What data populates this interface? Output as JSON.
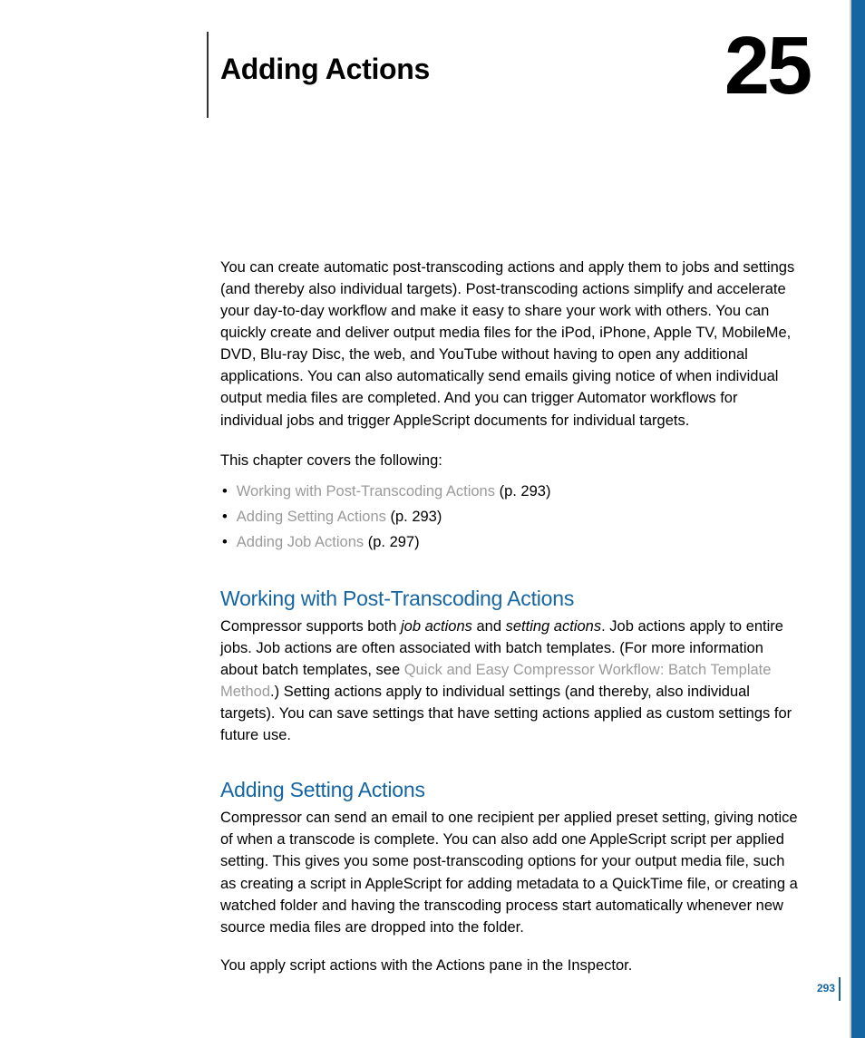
{
  "chapter": {
    "title": "Adding Actions",
    "number": "25"
  },
  "intro": "You can create automatic post-transcoding actions and apply them to jobs and settings (and thereby also individual targets). Post-transcoding actions simplify and accelerate your day-to-day workflow and make it easy to share your work with others. You can quickly create and deliver output media files for the iPod, iPhone, Apple TV, MobileMe, DVD, Blu-ray Disc, the web, and YouTube without having to open any additional applications. You can also automatically send emails giving notice of when individual output media files are completed. And you can trigger Automator workflows for individual jobs and trigger AppleScript documents for individual targets.",
  "covers_label": "This chapter covers the following:",
  "toc": [
    {
      "link": "Working with Post-Transcoding Actions",
      "page": " (p. 293)"
    },
    {
      "link": "Adding Setting Actions",
      "page": " (p. 293)"
    },
    {
      "link": "Adding Job Actions",
      "page": " (p. 297)"
    }
  ],
  "section1": {
    "heading": "Working with Post-Transcoding Actions",
    "pre": "Compressor supports both ",
    "ital1": "job actions",
    "mid1": " and ",
    "ital2": "setting actions",
    "post1": ". Job actions apply to entire jobs. Job actions are often associated with batch templates. (For more information about batch templates, see ",
    "crosslink": "Quick and Easy Compressor Workflow: Batch Template Method",
    "post2": ".) Setting actions apply to individual settings (and thereby, also individual targets). You can save settings that have setting actions applied as custom settings for future use."
  },
  "section2": {
    "heading": "Adding Setting Actions",
    "body1": "Compressor can send an email to one recipient per applied preset setting, giving notice of when a transcode is complete. You can also add one AppleScript script per applied setting. This gives you some post-transcoding options for your output media file, such as creating a script in AppleScript for adding metadata to a QuickTime file, or creating a watched folder and having the transcoding process start automatically whenever new source media files are dropped into the folder.",
    "body2": "You apply script actions with the Actions pane in the Inspector."
  },
  "page_number": "293"
}
